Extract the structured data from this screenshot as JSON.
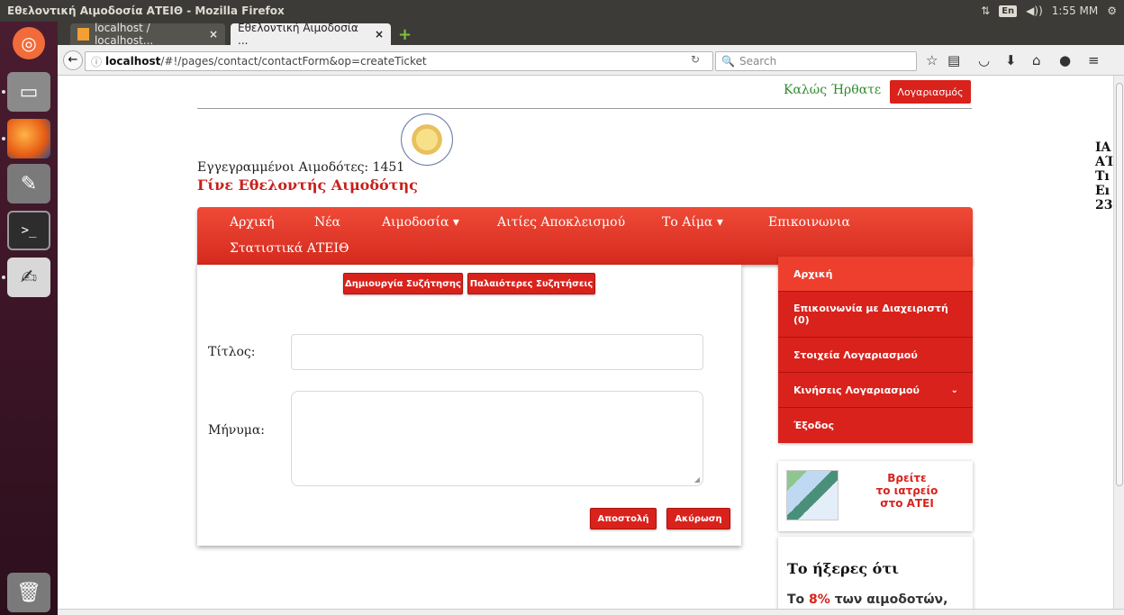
{
  "window": {
    "title": "Εθελοντική Αιμοδοσία ΑΤΕΙΘ - Mozilla Firefox"
  },
  "system": {
    "lang": "En",
    "time": "1:55 MM"
  },
  "tabs": [
    {
      "label": "localhost / localhost..."
    },
    {
      "label": "Εθελοντική Αιμοδοσία ..."
    }
  ],
  "browser": {
    "url_host": "localhost",
    "url_path": "/#!/pages/contact/contactForm&op=createTicket",
    "search_placeholder": "Search"
  },
  "header": {
    "welcome": "Καλώς Ήρθατε",
    "account_button": "Λογαριασμός",
    "registered_donors": "Εγγεγραμμένοι Αιμοδότες: 1451",
    "become_donor": "Γίνε Εθελοντής Αιμοδότης"
  },
  "right_edge_text": [
    "ΙΑ",
    "ΑΊ",
    "Τı",
    "Eı",
    "23"
  ],
  "nav": {
    "items": [
      {
        "label": "Αρχική"
      },
      {
        "label": "Νέα"
      },
      {
        "label": "Αιμοδοσία ▾"
      },
      {
        "label": "Αιτίες Αποκλεισμού"
      },
      {
        "label": "Το Αίμα ▾"
      },
      {
        "label": "Επικοινωνια"
      },
      {
        "label": "Στατιστικά ΑΤΕΙΘ"
      }
    ]
  },
  "contact": {
    "create_discussion": "Δημιουργία Συζήτησης",
    "older_discussions": "Παλαιότερες Συζητήσεις",
    "title_label": "Τίτλος:",
    "message_label": "Μήνυμα:",
    "title_value": "",
    "message_value": "",
    "send_button": "Αποστολή",
    "cancel_button": "Ακύρωση"
  },
  "sidemenu": {
    "items": [
      {
        "label": "Αρχική"
      },
      {
        "label": "Επικοινωνία με Διαχειριστή (0)"
      },
      {
        "label": "Στοιχεία Λογαριασμού"
      },
      {
        "label": "Κινήσεις Λογαριασμού"
      },
      {
        "label": "Έξοδος"
      }
    ]
  },
  "clinic": {
    "line1": "Βρείτε",
    "line2": "το ιατρείο",
    "line3": "στο ΑΤΕΙ"
  },
  "didyou": {
    "title": "Το ήξερες ότι",
    "pct": "8%",
    "text": "των αιμοδοτών,"
  },
  "colors": {
    "accent": "#d9221c",
    "welcome": "#2e8b2e"
  }
}
